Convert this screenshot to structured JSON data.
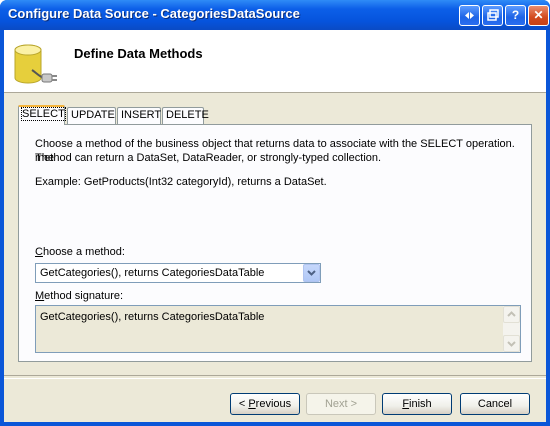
{
  "window": {
    "title": "Configure Data Source - CategoriesDataSource",
    "controls": {
      "help": "?",
      "close": "✕"
    }
  },
  "header": {
    "title": "Define Data Methods"
  },
  "tabs": [
    {
      "label": "SELECT",
      "active": true
    },
    {
      "label": "UPDATE",
      "active": false
    },
    {
      "label": "INSERT",
      "active": false
    },
    {
      "label": "DELETE",
      "active": false
    }
  ],
  "panel": {
    "description_line1": "Choose a method of the business object that returns data to associate with the SELECT operation. The",
    "description_line2": "method can return a DataSet, DataReader, or strongly-typed collection.",
    "example": "Example: GetProducts(Int32 categoryId), returns a DataSet.",
    "choose_method_label_accel": "C",
    "choose_method_label_rest": "hoose a method:",
    "choose_method_value": "GetCategories(), returns CategoriesDataTable",
    "signature_label_accel": "M",
    "signature_label_rest": "ethod signature:",
    "signature_value": "GetCategories(), returns CategoriesDataTable"
  },
  "buttons": {
    "previous_prefix": "< ",
    "previous_accel": "P",
    "previous_rest": "revious",
    "next": "Next >",
    "finish_accel": "F",
    "finish_rest": "inish",
    "cancel": "Cancel"
  }
}
